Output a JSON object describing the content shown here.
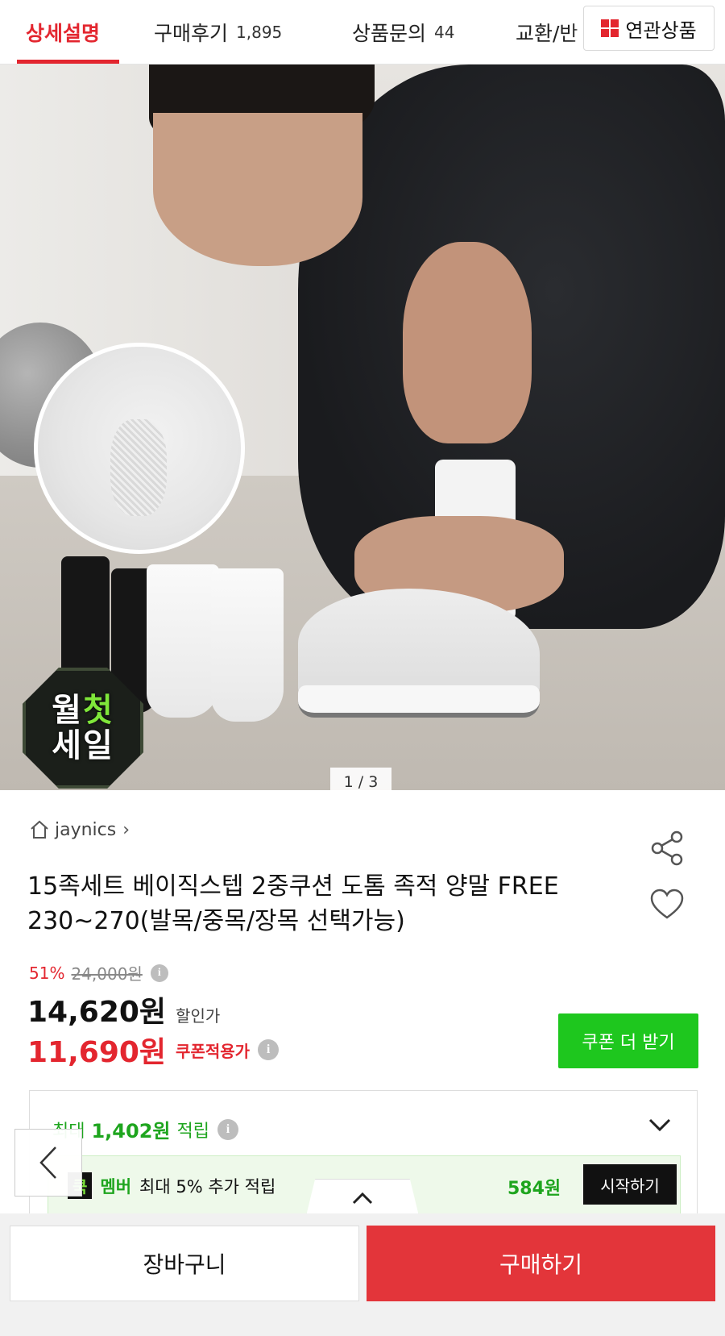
{
  "tabs": [
    {
      "label": "상세설명",
      "count": ""
    },
    {
      "label": "구매후기",
      "count": "1,895"
    },
    {
      "label": "상품문의",
      "count": "44"
    },
    {
      "label": "교환/반",
      "count": ""
    }
  ],
  "related_label": "연관상품",
  "image": {
    "badge_line1": "월",
    "badge_line1_accent": "첫",
    "badge_line2": "세일",
    "pager": "1 / 3"
  },
  "seller": {
    "name": "jaynics"
  },
  "product": {
    "title": "15족세트 베이직스텝 2중쿠션 도톰 족적 양말 FREE 230~270(발목/중목/장목 선택가능)"
  },
  "price": {
    "discount_pct": "51%",
    "original": "24,000원",
    "sale": "14,620원",
    "sale_label": "할인가",
    "coupon": "11,690원",
    "coupon_label": "쿠폰적용가",
    "coupon_button": "쿠폰 더 받기",
    "info_glyph": "i"
  },
  "points": {
    "prefix": "최대",
    "amount": "1,402원",
    "suffix": "적립",
    "member_logo": "쿡",
    "member_name": "멤버",
    "member_text": "최대 5% 추가 적립",
    "member_amount": "584원",
    "start_button": "시작하기"
  },
  "bottom": {
    "cart": "장바구니",
    "buy": "구매하기"
  },
  "colors": {
    "accent_red": "#e3262f",
    "buy_red": "#e3353a",
    "green": "#1ec71e"
  }
}
